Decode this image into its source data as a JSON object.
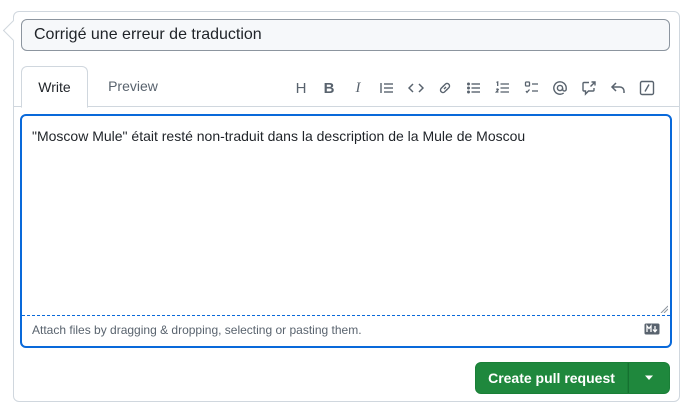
{
  "title_input": {
    "value": "Corrigé une erreur de traduction"
  },
  "tabs": {
    "write": "Write",
    "preview": "Preview"
  },
  "toolbar": {
    "icons": [
      "heading-icon",
      "bold-icon",
      "italic-icon",
      "quote-icon",
      "code-icon",
      "link-icon",
      "unordered-list-icon",
      "ordered-list-icon",
      "task-list-icon",
      "mention-icon",
      "cross-reference-icon",
      "reply-icon",
      "slash-commands-icon"
    ],
    "heading_glyph": "H",
    "bold_glyph": "B",
    "italic_glyph": "I"
  },
  "editor": {
    "text": "\"Moscow Mule\" était resté non-traduit dans la description de la Mule de Moscou",
    "attach_hint": "Attach files by dragging & dropping, selecting or pasting them."
  },
  "actions": {
    "create_label": "Create pull request"
  },
  "colors": {
    "accent": "#0969da",
    "primary_button": "#1f883d",
    "border": "#d0d7de",
    "muted_text": "#59636e"
  }
}
